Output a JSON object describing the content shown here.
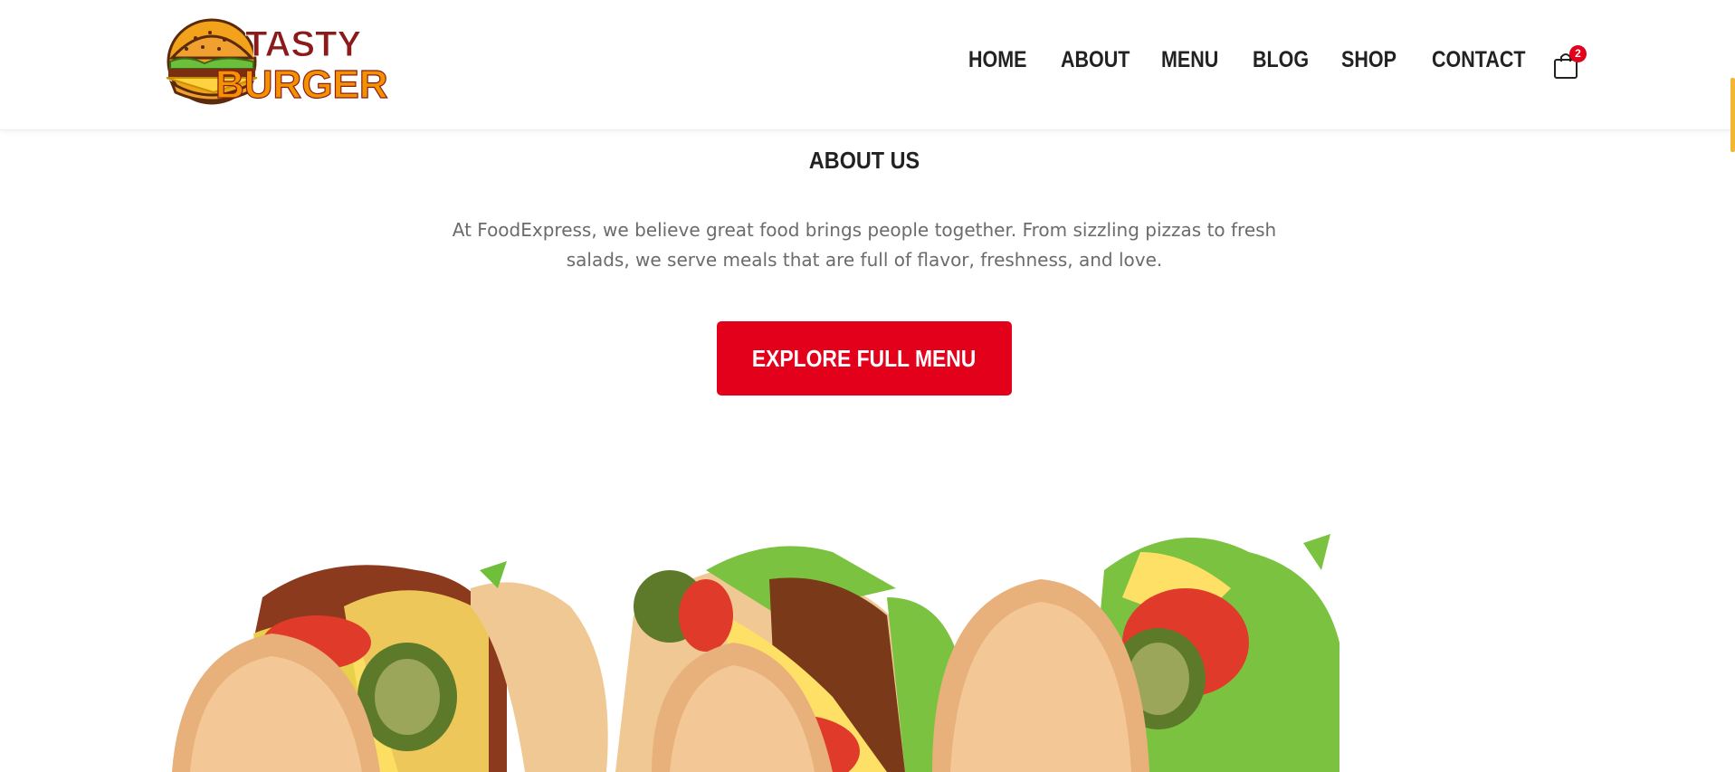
{
  "brand": {
    "logo_line1": "TASTY",
    "logo_line2": "BURGER",
    "colors": {
      "red": "#8b1a1a",
      "orange": "#f39200",
      "accent": "#e3001b"
    }
  },
  "nav": {
    "items": [
      {
        "label": "HOME"
      },
      {
        "label": "ABOUT"
      },
      {
        "label": "MENU"
      },
      {
        "label": "BLOG"
      },
      {
        "label": "SHOP"
      },
      {
        "label": "CONTACT"
      }
    ],
    "cart": {
      "icon": "shopping-bag-icon",
      "count": "2"
    }
  },
  "about": {
    "title": "ABOUT US",
    "text": "At FoodExpress, we believe great food brings people together. From sizzling pizzas to fresh salads, we serve meals that are full of flavor, freshness, and love.",
    "cta_label": "EXPLORE FULL MENU"
  }
}
